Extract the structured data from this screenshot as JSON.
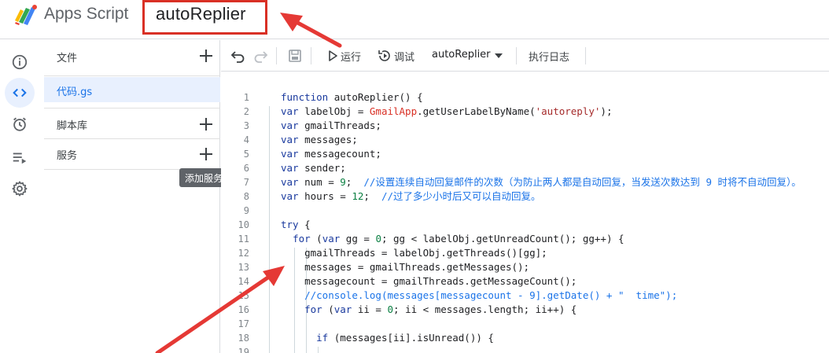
{
  "header": {
    "app_name": "Apps Script",
    "project_name": "autoReplier"
  },
  "rail": [
    {
      "icon": "info-icon"
    },
    {
      "icon": "code-icon",
      "active": true
    },
    {
      "icon": "alarm-icon"
    },
    {
      "icon": "executions-icon"
    },
    {
      "icon": "gear-icon"
    }
  ],
  "files": {
    "files_label": "文件",
    "current_file": "代码.gs",
    "libraries_label": "脚本库",
    "services_label": "服务",
    "tooltip": "添加服务"
  },
  "toolbar": {
    "run_label": "运行",
    "debug_label": "调试",
    "function_select": "autoReplier",
    "log_label": "执行日志"
  },
  "code": [
    {
      "n": "1",
      "tokens": [
        [
          "kw",
          "function"
        ],
        [
          "fn",
          " autoReplier() {"
        ]
      ]
    },
    {
      "n": "2",
      "tokens": [
        [
          "kw",
          "var"
        ],
        [
          "fn",
          " labelObj = "
        ],
        [
          "cls",
          "GmailApp"
        ],
        [
          "fn",
          ".getUserLabelByName("
        ],
        [
          "str",
          "'autoreply'"
        ],
        [
          "fn",
          ");"
        ]
      ]
    },
    {
      "n": "3",
      "tokens": [
        [
          "kw",
          "var"
        ],
        [
          "fn",
          " gmailThreads;"
        ]
      ]
    },
    {
      "n": "4",
      "tokens": [
        [
          "kw",
          "var"
        ],
        [
          "fn",
          " messages;"
        ]
      ]
    },
    {
      "n": "5",
      "tokens": [
        [
          "kw",
          "var"
        ],
        [
          "fn",
          " messagecount;"
        ]
      ]
    },
    {
      "n": "6",
      "tokens": [
        [
          "kw",
          "var"
        ],
        [
          "fn",
          " sender;"
        ]
      ]
    },
    {
      "n": "7",
      "tokens": [
        [
          "kw",
          "var"
        ],
        [
          "fn",
          " num = "
        ],
        [
          "num",
          "9"
        ],
        [
          "fn",
          ";  "
        ],
        [
          "cmt",
          "//设置连续自动回复邮件的次数（为防止两人都是自动回复，当发送次数达到 9 时将不自动回复）。"
        ]
      ]
    },
    {
      "n": "8",
      "tokens": [
        [
          "kw",
          "var"
        ],
        [
          "fn",
          " hours = "
        ],
        [
          "num",
          "12"
        ],
        [
          "fn",
          ";  "
        ],
        [
          "cmt",
          "//过了多少小时后又可以自动回复。"
        ]
      ]
    },
    {
      "n": "9",
      "tokens": []
    },
    {
      "n": "10",
      "tokens": [
        [
          "kw",
          "try"
        ],
        [
          "fn",
          " {"
        ]
      ]
    },
    {
      "n": "11",
      "tokens": [
        [
          "fn",
          "  "
        ],
        [
          "kw",
          "for"
        ],
        [
          "fn",
          " ("
        ],
        [
          "kw",
          "var"
        ],
        [
          "fn",
          " gg = "
        ],
        [
          "num",
          "0"
        ],
        [
          "fn",
          "; gg < labelObj.getUnreadCount(); gg++) {"
        ]
      ]
    },
    {
      "n": "12",
      "tokens": [
        [
          "fn",
          "    gmailThreads = labelObj.getThreads()[gg];"
        ]
      ]
    },
    {
      "n": "13",
      "tokens": [
        [
          "fn",
          "    messages = gmailThreads.getMessages();"
        ]
      ]
    },
    {
      "n": "14",
      "tokens": [
        [
          "fn",
          "    messagecount = gmailThreads.getMessageCount();"
        ]
      ]
    },
    {
      "n": "15",
      "tokens": [
        [
          "fn",
          "    "
        ],
        [
          "cmt",
          "//console.log(messages[messagecount - 9].getDate() + \"  time\");"
        ]
      ]
    },
    {
      "n": "16",
      "tokens": [
        [
          "fn",
          "    "
        ],
        [
          "kw",
          "for"
        ],
        [
          "fn",
          " ("
        ],
        [
          "kw",
          "var"
        ],
        [
          "fn",
          " ii = "
        ],
        [
          "num",
          "0"
        ],
        [
          "fn",
          "; ii < messages.length; ii++) {"
        ]
      ]
    },
    {
      "n": "17",
      "tokens": []
    },
    {
      "n": "18",
      "tokens": [
        [
          "fn",
          "      "
        ],
        [
          "kw",
          "if"
        ],
        [
          "fn",
          " (messages[ii].isUnread()) {"
        ]
      ]
    },
    {
      "n": "19",
      "tokens": []
    }
  ],
  "colors": {
    "accent": "#1a73e8",
    "highlight_box": "#d93025",
    "arrow": "#e53935"
  }
}
